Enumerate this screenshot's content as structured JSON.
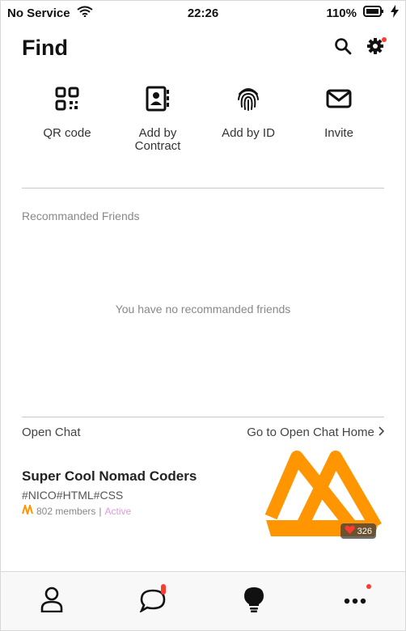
{
  "status_bar": {
    "carrier": "No Service",
    "time": "22:26",
    "battery": "110%"
  },
  "header": {
    "title": "Find"
  },
  "quick_actions": [
    {
      "label": "QR code",
      "icon": "qr-code-icon"
    },
    {
      "label": "Add by\nContract",
      "icon": "contact-book-icon"
    },
    {
      "label": "Add by ID",
      "icon": "fingerprint-icon"
    },
    {
      "label": "Invite",
      "icon": "envelope-icon"
    }
  ],
  "recommended": {
    "title": "Recommanded Friends",
    "empty_text": "You have no recommanded friends"
  },
  "open_chat": {
    "title": "Open Chat",
    "home_link": "Go to Open Chat Home",
    "chat": {
      "name": "Super Cool Nomad Coders",
      "tags": "#NICO#HTML#CSS",
      "members": "802 members",
      "separator": "|",
      "status": "Active",
      "likes": "326"
    }
  },
  "colors": {
    "accent": "#ff9500",
    "notification": "#ff3b30",
    "active": "#d9a0d6"
  },
  "tab_bar": [
    "person-icon",
    "chat-bubble-icon",
    "lightbulb-icon",
    "more-dots-icon"
  ]
}
